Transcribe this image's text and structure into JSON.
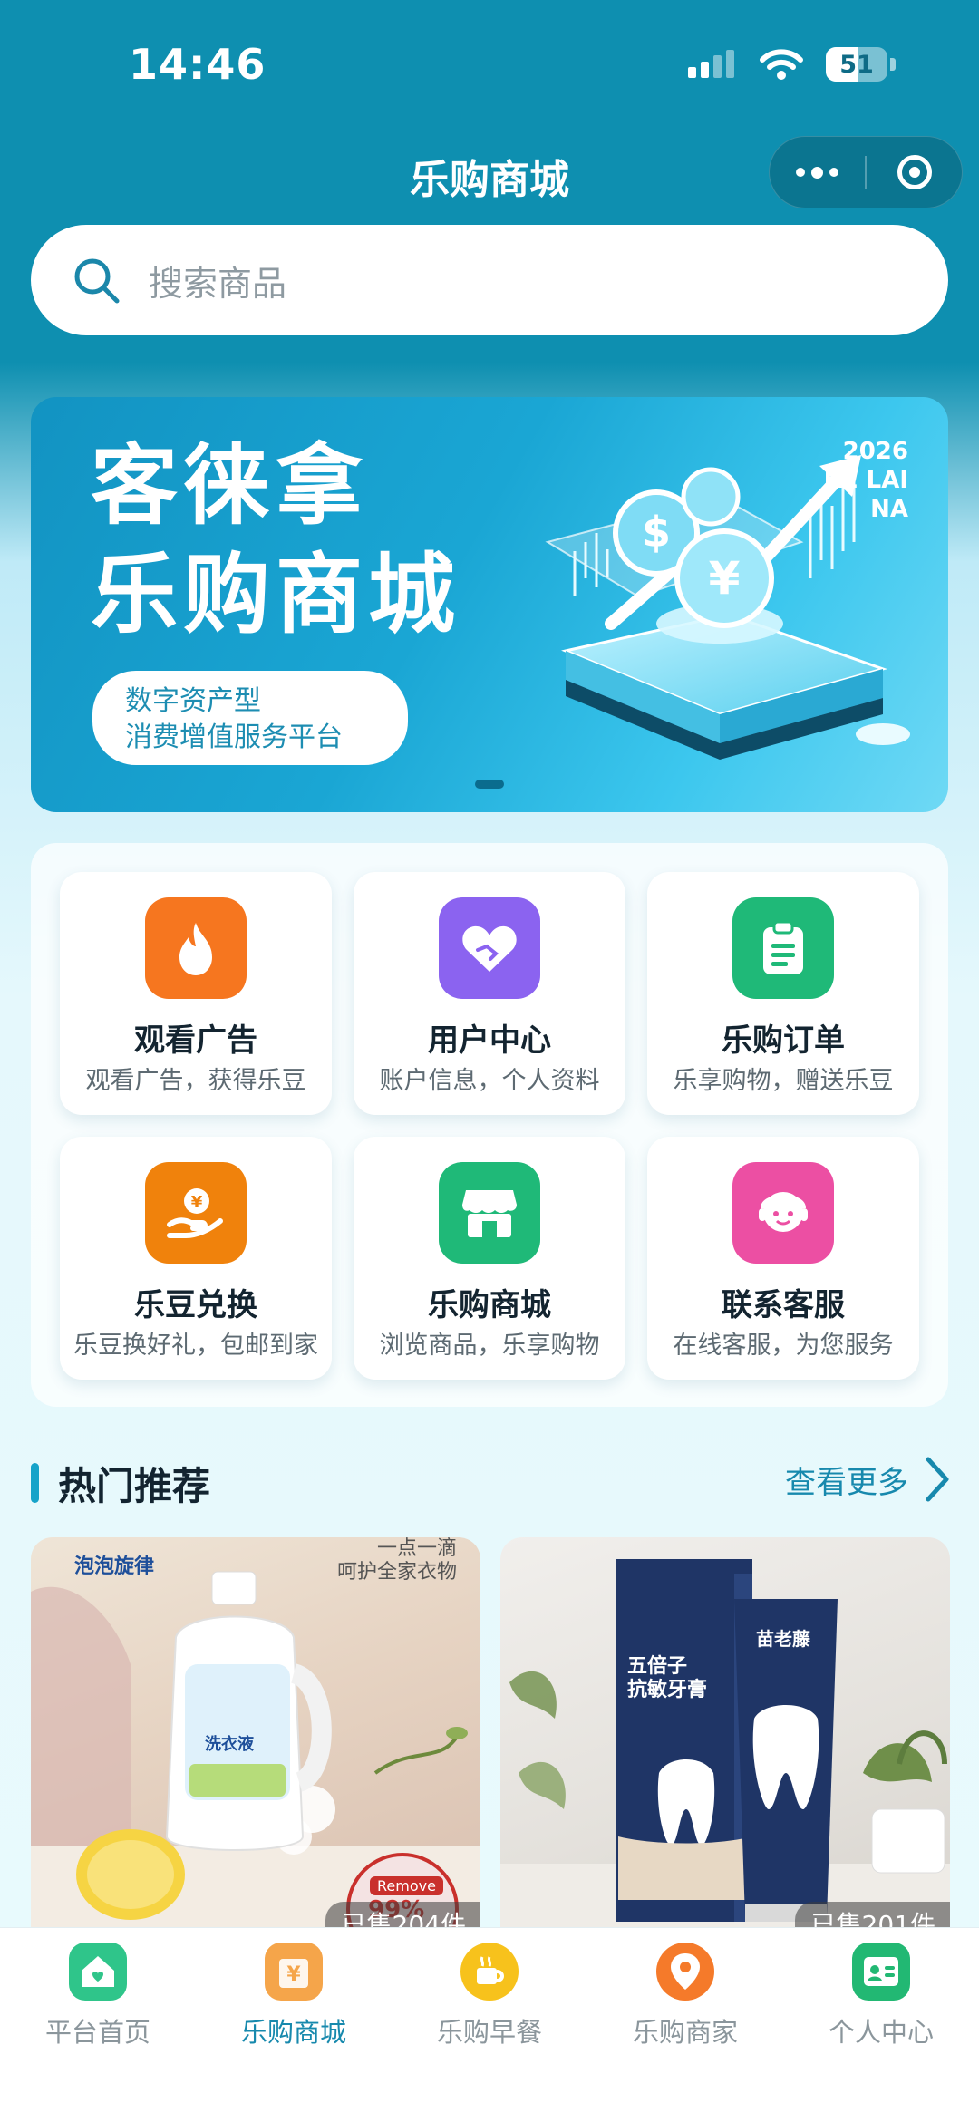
{
  "status_bar": {
    "time": "14:46",
    "battery": "51",
    "battery_level": 0.51
  },
  "header": {
    "title": "乐购商城"
  },
  "search": {
    "placeholder": "搜索商品"
  },
  "banner": {
    "title_line1": "客徕拿",
    "title_line2": "乐购商城",
    "tagline_line1": "数字资产型",
    "tagline_line2": "消费增值服务平台",
    "year": "2026",
    "brand": "KE LAI NA"
  },
  "menu": [
    {
      "title": "观看广告",
      "desc": "观看广告，获得乐豆",
      "icon": "flame-icon",
      "color": "#f6761f"
    },
    {
      "title": "用户中心",
      "desc": "账户信息，个人资料",
      "icon": "heart-handshake-icon",
      "color": "#8b63f0"
    },
    {
      "title": "乐购订单",
      "desc": "乐享购物，赠送乐豆",
      "icon": "clipboard-icon",
      "color": "#1fb978"
    },
    {
      "title": "乐豆兑换",
      "desc": "乐豆换好礼，包邮到家",
      "icon": "coin-hand-icon",
      "color": "#f0820c"
    },
    {
      "title": "乐购商城",
      "desc": "浏览商品，乐享购物",
      "icon": "store-icon",
      "color": "#1fb978"
    },
    {
      "title": "联系客服",
      "desc": "在线客服，为您服务",
      "icon": "support-agent-icon",
      "color": "#ec4fa3"
    }
  ],
  "section": {
    "title": "热门推荐",
    "more": "查看更多"
  },
  "products": [
    {
      "brand": "泡泡旋律",
      "slogan_1": "一点一滴",
      "slogan_2": "呵护全家衣物",
      "product_label": "洗衣液",
      "badge_top": "Remove",
      "badge_value": "99%",
      "sold": "已售204件"
    },
    {
      "brand": "苗老藤",
      "name_line1": "五倍子",
      "name_line2": "抗敏牙膏",
      "sold": "已售201件"
    }
  ],
  "tabbar": [
    {
      "label": "平台首页",
      "icon": "home-icon",
      "color": "#2fc58a",
      "active": false
    },
    {
      "label": "乐购商城",
      "icon": "shop-bag-icon",
      "color": "#f5a54a",
      "active": true
    },
    {
      "label": "乐购早餐",
      "icon": "breakfast-icon",
      "color": "#f7c21c",
      "active": false
    },
    {
      "label": "乐购商家",
      "icon": "location-pin-icon",
      "color": "#f57a2a",
      "active": false
    },
    {
      "label": "个人中心",
      "icon": "id-card-icon",
      "color": "#22b873",
      "active": false
    }
  ]
}
